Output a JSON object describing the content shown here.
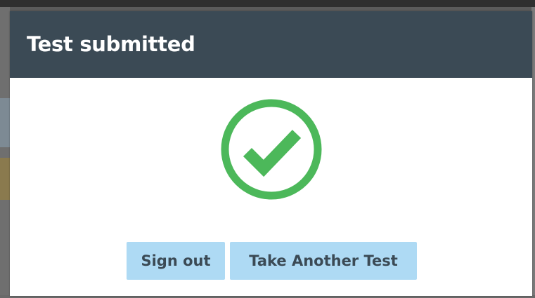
{
  "dialog": {
    "title": "Test submitted",
    "status_icon": "check-circle-icon",
    "buttons": {
      "sign_out_label": "Sign out",
      "take_another_label": "Take Another Test"
    }
  },
  "colors": {
    "header_bg": "#3b4a55",
    "success_green": "#4cb85a",
    "button_bg": "#aedaf4",
    "button_text": "#3b4a55"
  }
}
